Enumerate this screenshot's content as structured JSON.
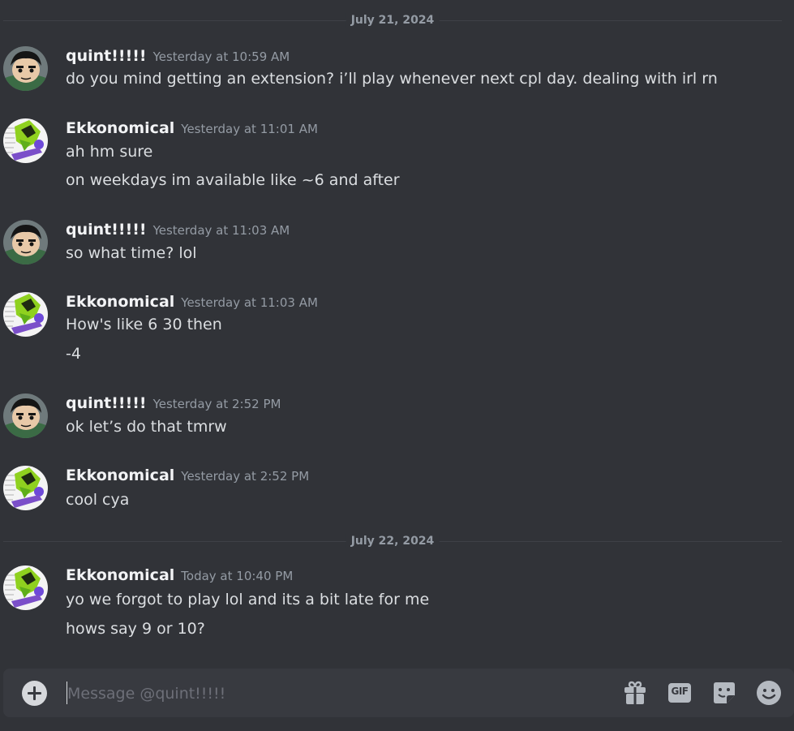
{
  "colors": {
    "background": "#313338",
    "composer_background": "#383a40",
    "username": "#f2f3f5",
    "muted": "#949ba4",
    "text": "#dbdee1"
  },
  "dividers": [
    "July 21, 2024",
    "July 22, 2024"
  ],
  "messages": [
    {
      "username": "quint!!!!!",
      "timestamp": "Yesterday at 10:59 AM",
      "avatar_icon": "anime-character-avatar",
      "lines": [
        "do you mind getting an extension? i’ll play whenever next cpl day. dealing with irl rn"
      ]
    },
    {
      "username": "Ekkonomical",
      "timestamp": "Yesterday at 11:01 AM",
      "avatar_icon": "green-character-avatar",
      "lines": [
        "ah hm sure",
        "on weekdays im available like ~6 and after"
      ]
    },
    {
      "username": "quint!!!!!",
      "timestamp": "Yesterday at 11:03 AM",
      "avatar_icon": "anime-character-avatar",
      "lines": [
        "so what time? lol"
      ]
    },
    {
      "username": "Ekkonomical",
      "timestamp": "Yesterday at 11:03 AM",
      "avatar_icon": "green-character-avatar",
      "lines": [
        "How's like 6 30 then",
        "-4"
      ]
    },
    {
      "username": "quint!!!!!",
      "timestamp": "Yesterday at 2:52 PM",
      "avatar_icon": "anime-character-avatar",
      "lines": [
        "ok let’s do that tmrw"
      ]
    },
    {
      "username": "Ekkonomical",
      "timestamp": "Yesterday at 2:52 PM",
      "avatar_icon": "green-character-avatar",
      "lines": [
        "cool cya"
      ]
    },
    {
      "username": "Ekkonomical",
      "timestamp": "Today at 10:40 PM",
      "avatar_icon": "green-character-avatar",
      "lines": [
        "yo we forgot to play lol and its a bit late for me",
        "hows say 9 or 10?"
      ]
    }
  ],
  "composer": {
    "placeholder": "Message @quint!!!!!",
    "value": "",
    "tools": [
      "plus-circle-icon",
      "gift-icon",
      "gif-icon",
      "sticker-icon",
      "emoji-icon"
    ],
    "gif_label": "GIF"
  }
}
